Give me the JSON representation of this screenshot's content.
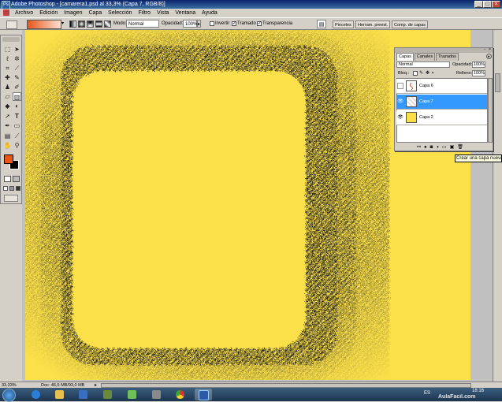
{
  "window": {
    "title": "Adobe Photoshop - [camarera1.psd al 33,3% (Capa 7, RGB/8)]",
    "minimize": "_",
    "maximize": "□",
    "close": "×"
  },
  "menu": [
    "Archivo",
    "Edición",
    "Imagen",
    "Capa",
    "Selección",
    "Filtro",
    "Vista",
    "Ventana",
    "Ayuda"
  ],
  "options": {
    "mode_label": "Modo:",
    "mode_value": "Normal",
    "opacity_label": "Opacidad:",
    "opacity_value": "100%",
    "invert_label": "Invertir",
    "dither_label": "Tramado",
    "transparency_label": "Transparencia",
    "well_tabs": [
      "Pinceles",
      "Herram. preest.",
      "Comp. de capas"
    ]
  },
  "layers_panel": {
    "tabs": [
      "Capas",
      "Canales",
      "Trazados"
    ],
    "blend_mode": "Normal",
    "opacity_label": "Opacidad:",
    "opacity_value": "100%",
    "lock_label": "Bloq.:",
    "fill_label": "Relleno:",
    "fill_value": "100%",
    "layers": [
      {
        "name": "Capa 6",
        "visible": false,
        "selected": false
      },
      {
        "name": "Capa 7",
        "visible": true,
        "selected": true
      },
      {
        "name": "Capa 2",
        "visible": true,
        "selected": false
      }
    ],
    "tooltip": "Crear una capa nueva"
  },
  "status": {
    "zoom": "33,33%",
    "doc_info": "Doc: 46,5 MB/93,0 MB"
  },
  "taskbar": {
    "lang": "ES",
    "time": "18:16",
    "watermark": "AulaFacil.com"
  },
  "colors": {
    "canvas": "#fbe04a",
    "hatch": "#1a1a1a",
    "foreground": "#e8561a",
    "background": "#000000",
    "selection": "#3399ff"
  }
}
